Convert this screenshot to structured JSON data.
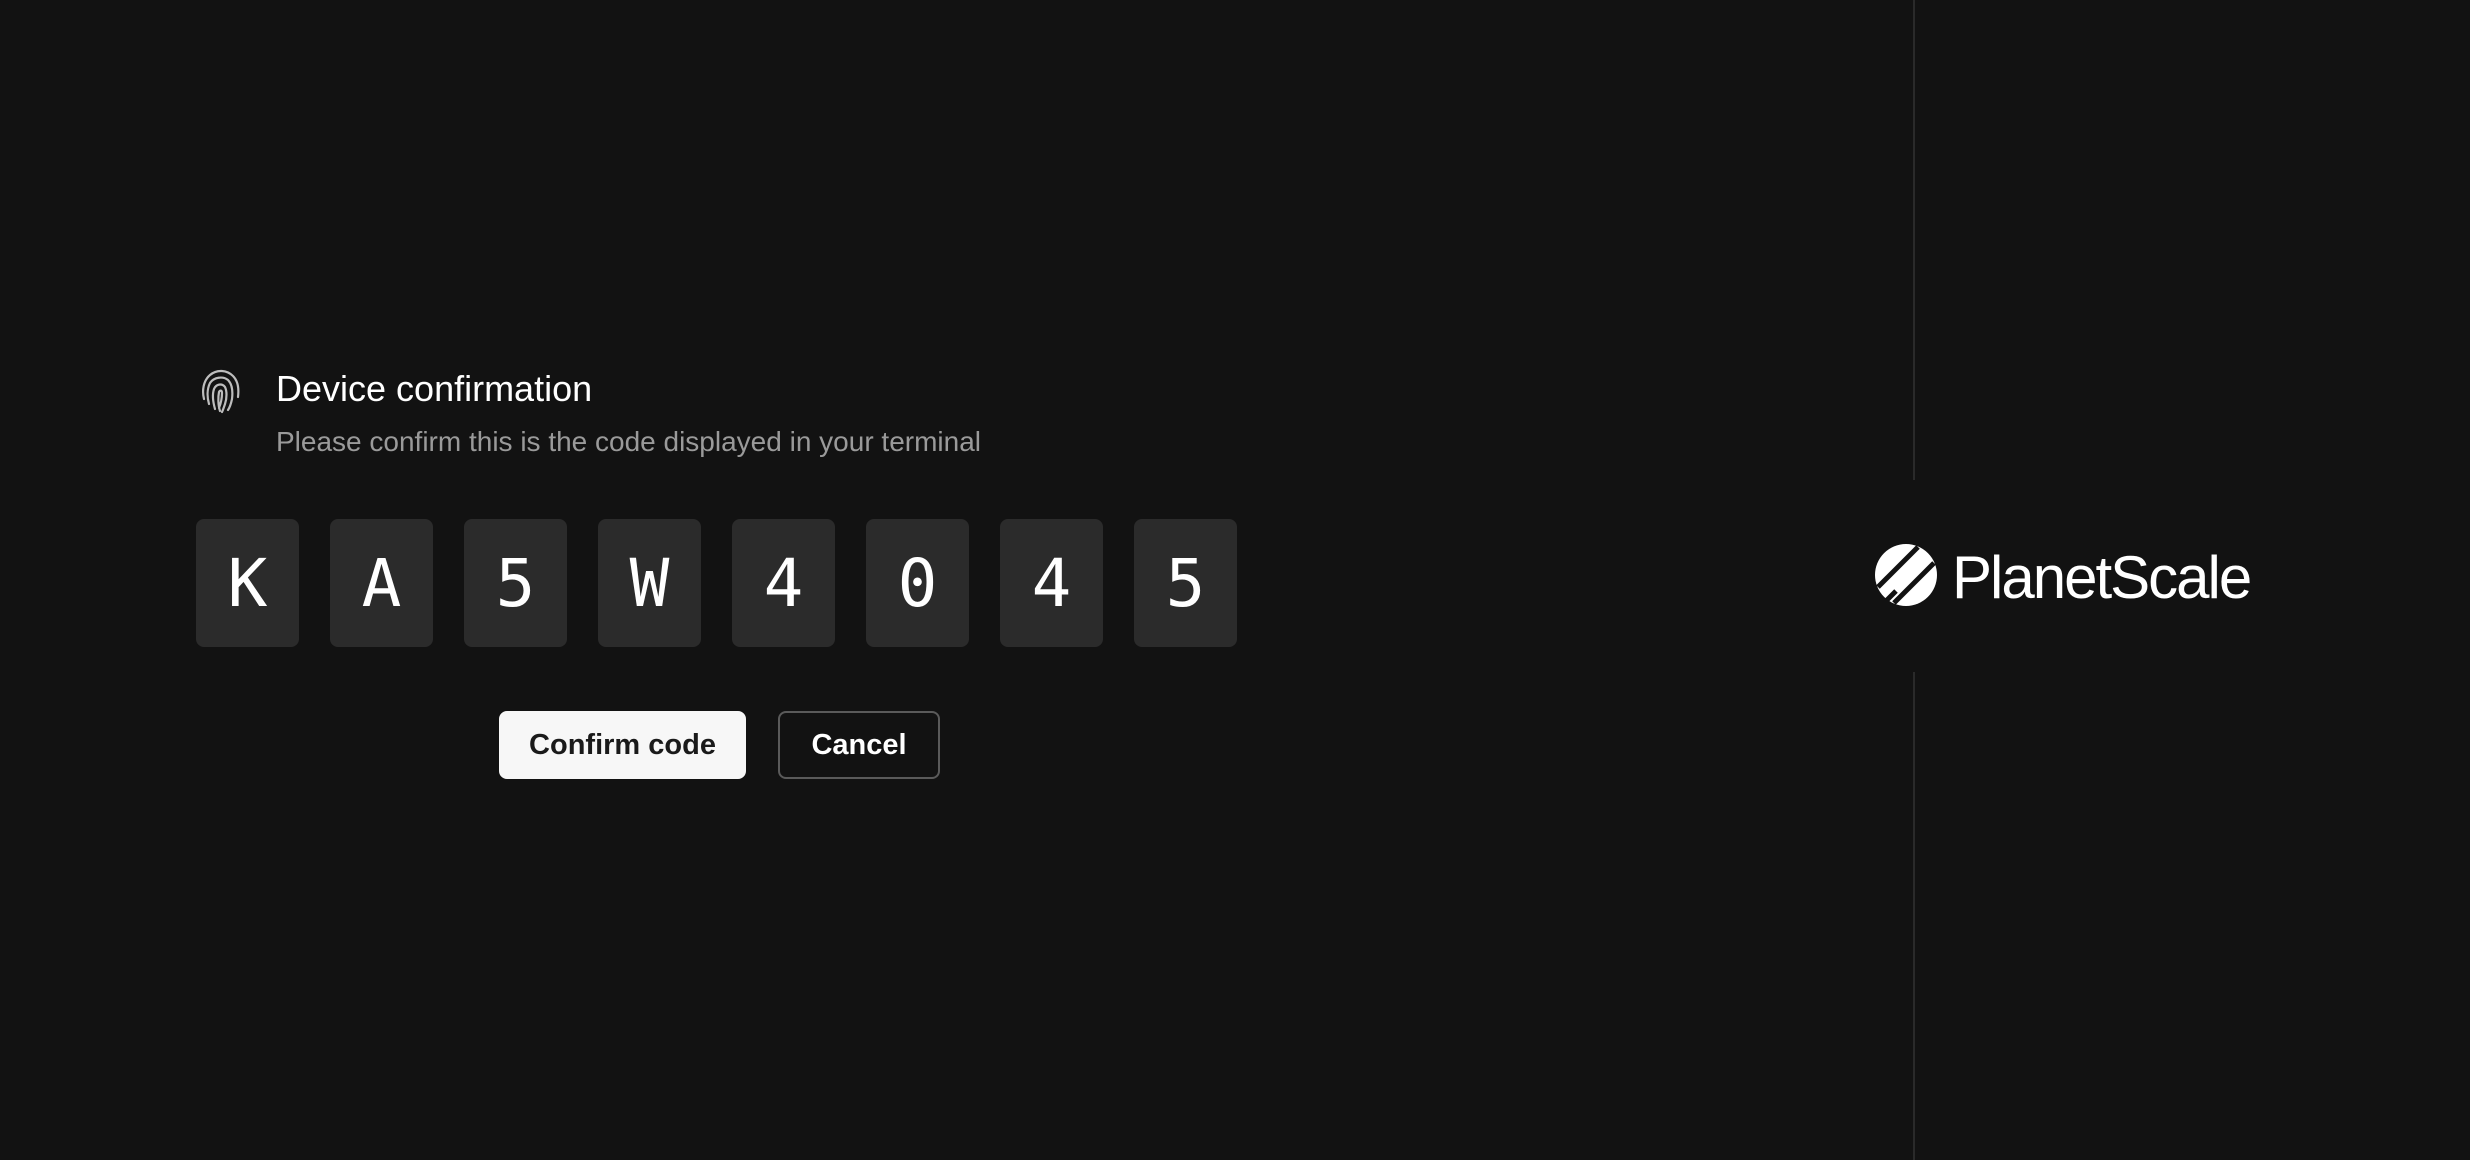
{
  "dialog": {
    "title": "Device confirmation",
    "subtitle": "Please confirm this is the code displayed in your terminal",
    "code": [
      "K",
      "A",
      "5",
      "W",
      "4",
      "0",
      "4",
      "5"
    ]
  },
  "actions": {
    "confirm_label": "Confirm code",
    "cancel_label": "Cancel"
  },
  "brand": {
    "name": "PlanetScale"
  },
  "icons": {
    "header": "fingerprint-icon",
    "logo": "planetscale-logo-icon"
  },
  "colors": {
    "background": "#121212",
    "code_box": "#2b2b2b",
    "primary_button": "#f7f7f7",
    "subtitle_text": "#9a9a9a"
  }
}
